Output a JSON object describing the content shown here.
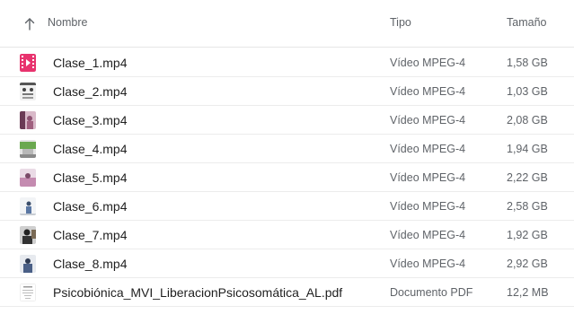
{
  "header": {
    "sort_icon": "arrow-up-icon",
    "name_label": "Nombre",
    "type_label": "Tipo",
    "size_label": "Tamaño"
  },
  "files": [
    {
      "name": "Clase_1.mp4",
      "type": "Vídeo MPEG-4",
      "size": "1,58 GB",
      "icon": "video-file-icon",
      "accent": "#e8336e"
    },
    {
      "name": "Clase_2.mp4",
      "type": "Vídeo MPEG-4",
      "size": "1,03 GB",
      "icon": "video-thumbnail-icon",
      "accent": "#8a8a8a"
    },
    {
      "name": "Clase_3.mp4",
      "type": "Vídeo MPEG-4",
      "size": "2,08 GB",
      "icon": "video-thumbnail-icon",
      "accent": "#b46a8c"
    },
    {
      "name": "Clase_4.mp4",
      "type": "Vídeo MPEG-4",
      "size": "1,94 GB",
      "icon": "video-thumbnail-icon",
      "accent": "#6aa84f"
    },
    {
      "name": "Clase_5.mp4",
      "type": "Vídeo MPEG-4",
      "size": "2,22 GB",
      "icon": "video-thumbnail-icon",
      "accent": "#c48bb0"
    },
    {
      "name": "Clase_6.mp4",
      "type": "Vídeo MPEG-4",
      "size": "2,58 GB",
      "icon": "video-thumbnail-icon",
      "accent": "#9ab3c8"
    },
    {
      "name": "Clase_7.mp4",
      "type": "Vídeo MPEG-4",
      "size": "1,92 GB",
      "icon": "video-thumbnail-icon",
      "accent": "#3a3a3a"
    },
    {
      "name": "Clase_8.mp4",
      "type": "Vídeo MPEG-4",
      "size": "2,92 GB",
      "icon": "video-thumbnail-icon",
      "accent": "#4a5f86"
    },
    {
      "name": "Psicobiónica_MVI_LiberacionPsicosomática_AL.pdf",
      "type": "Documento PDF",
      "size": "12,2 MB",
      "icon": "pdf-thumbnail-icon",
      "accent": "#9a9a9a"
    }
  ]
}
